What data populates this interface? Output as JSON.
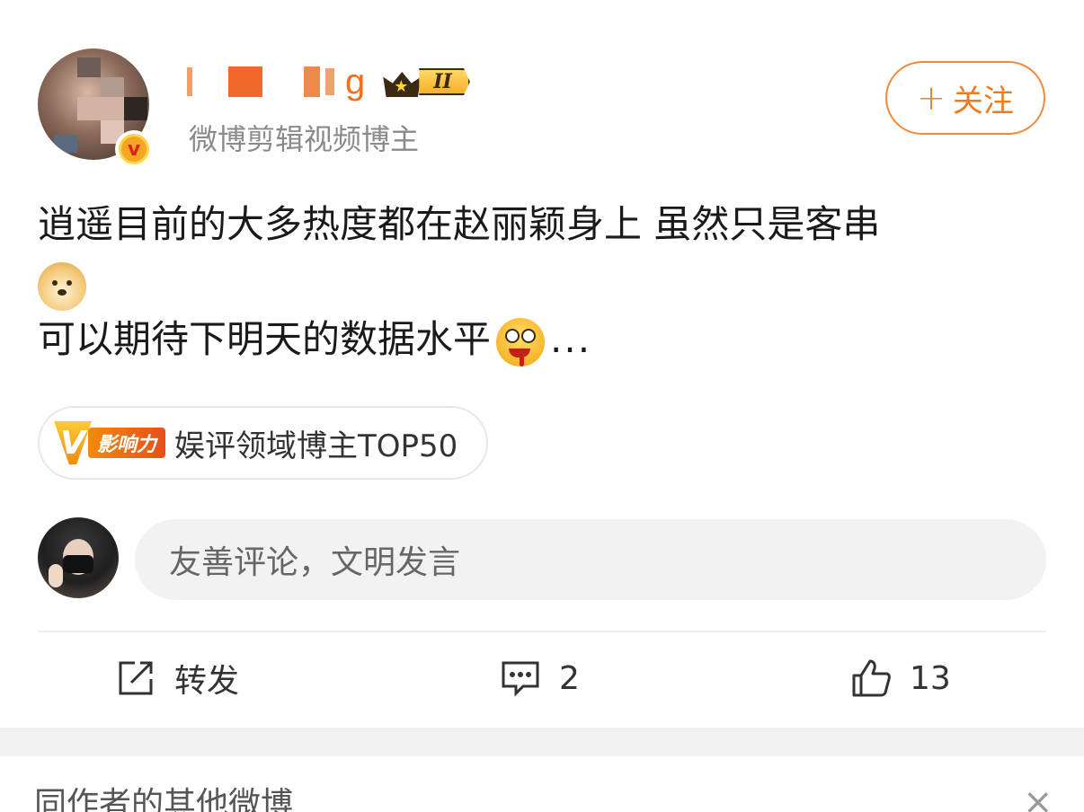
{
  "top_fragment": "",
  "author": {
    "username": "g",
    "level_badge": "II",
    "subtitle": "微博剪辑视频博主",
    "verified": true
  },
  "follow_button": {
    "plus": "+",
    "label": "关注"
  },
  "post": {
    "line1": "逍遥目前的大多热度都在赵丽颖身上 虽然只是客串",
    "line3": "可以期待下明天的数据水平",
    "more": "...",
    "emojis": [
      "doge-icon",
      "drool-icon"
    ]
  },
  "influence_tag": {
    "badge_letter": "V",
    "badge_text": "影响力",
    "label": "娱评领域博主TOP50"
  },
  "comment_box": {
    "placeholder": "友善评论，文明发言"
  },
  "actions": {
    "repost_label": "转发",
    "comment_count": "2",
    "like_count": "13"
  },
  "bottom_section": {
    "title": "同作者的其他微博",
    "close": "×"
  },
  "colors": {
    "accent": "#f07a1e",
    "text_primary": "#1a1a1a",
    "text_secondary": "#8a8a8a",
    "input_bg": "#f2f2f2",
    "band_bg": "#f1f1f1"
  }
}
